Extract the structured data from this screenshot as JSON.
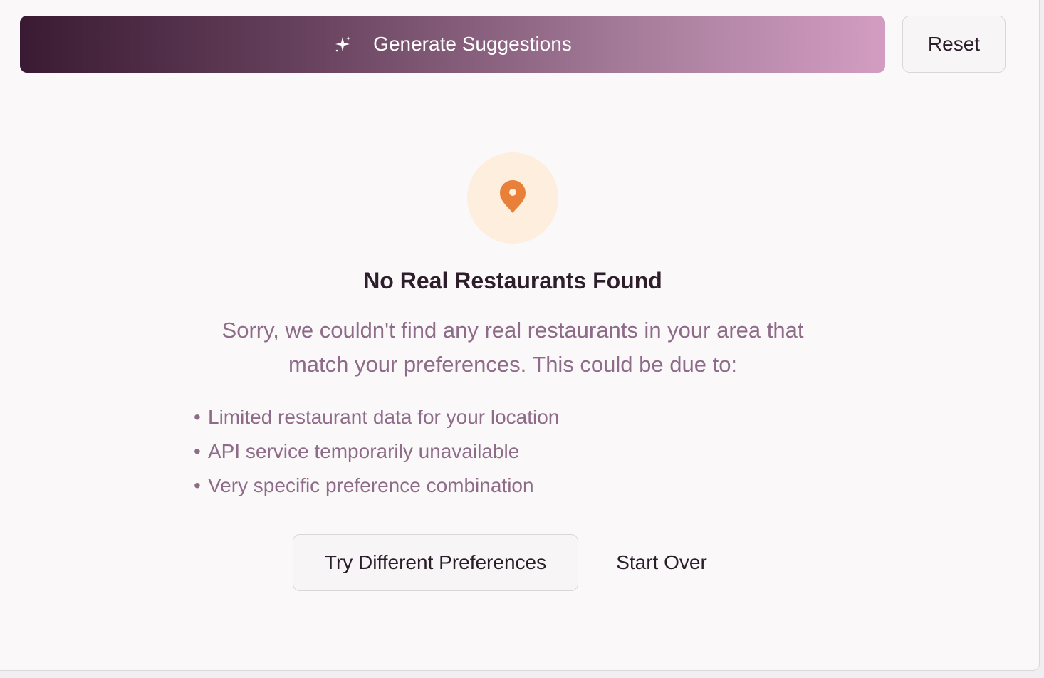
{
  "toolbar": {
    "generate_label": "Generate Suggestions",
    "generate_icon": "sparkles-icon",
    "reset_label": "Reset"
  },
  "empty_state": {
    "icon": "map-pin-icon",
    "title": "No Real Restaurants Found",
    "message": "Sorry, we couldn't find any real restaurants in your area that match your preferences. This could be due to:",
    "bullet": "•",
    "reasons": [
      "Limited restaurant data for your location",
      "API service temporarily unavailable",
      "Very specific preference combination"
    ],
    "try_label": "Try Different Preferences",
    "start_over_label": "Start Over"
  },
  "colors": {
    "gradient_start": "#3a1a33",
    "gradient_end": "#d39dc2",
    "pin": "#e8803a",
    "pin_background": "#fdeedd",
    "muted_text": "#8e6c89",
    "heading_text": "#2e1e2c"
  }
}
